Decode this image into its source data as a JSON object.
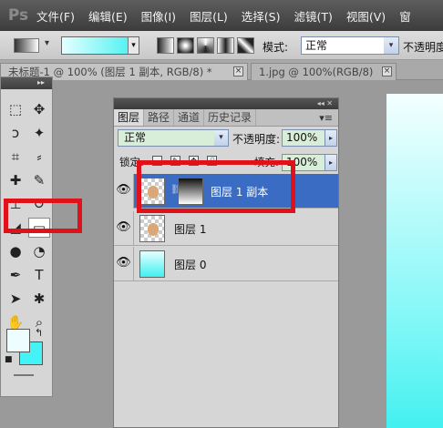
{
  "app": {
    "logo": "Ps"
  },
  "menu": [
    {
      "label": "文件(F)"
    },
    {
      "label": "编辑(E)"
    },
    {
      "label": "图像(I)"
    },
    {
      "label": "图层(L)"
    },
    {
      "label": "选择(S)"
    },
    {
      "label": "滤镜(T)"
    },
    {
      "label": "视图(V)"
    },
    {
      "label": "窗"
    }
  ],
  "options_bar": {
    "gradient_preview_colors": [
      "#e6ffff",
      "#3ff0f0"
    ],
    "mode_label": "模式:",
    "mode_value": "正常",
    "opacity_label": "不透明度"
  },
  "document_tabs": [
    {
      "label": "未标题-1 @ 100% (图层 1 副本, RGB/8) *",
      "close": "×"
    },
    {
      "label": "1.jpg @ 100%(RGB/8)",
      "close": "×"
    }
  ],
  "tools_panel": {
    "collapse_glyph": "▸▸",
    "tools": [
      {
        "name": "marquee-tool-icon",
        "glyph": "⬚"
      },
      {
        "name": "move-tool-icon",
        "glyph": "✥"
      },
      {
        "name": "lasso-tool-icon",
        "glyph": "ↄ"
      },
      {
        "name": "magic-wand-tool-icon",
        "glyph": "✦"
      },
      {
        "name": "crop-tool-icon",
        "glyph": "⌗"
      },
      {
        "name": "eyedropper-tool-icon",
        "glyph": "⸗"
      },
      {
        "name": "healing-brush-tool-icon",
        "glyph": "✚"
      },
      {
        "name": "brush-tool-icon",
        "glyph": "✎"
      },
      {
        "name": "clone-stamp-tool-icon",
        "glyph": "⊥"
      },
      {
        "name": "history-brush-tool-icon",
        "glyph": "↺"
      },
      {
        "name": "eraser-tool-icon",
        "glyph": "◢"
      },
      {
        "name": "gradient-tool-icon",
        "glyph": "▭",
        "selected": true
      },
      {
        "name": "blur-tool-icon",
        "glyph": "●"
      },
      {
        "name": "dodge-tool-icon",
        "glyph": "◔"
      },
      {
        "name": "pen-tool-icon",
        "glyph": "✒"
      },
      {
        "name": "type-tool-icon",
        "glyph": "T"
      },
      {
        "name": "path-selection-tool-icon",
        "glyph": "➤"
      },
      {
        "name": "shape-tool-icon",
        "glyph": "✱"
      },
      {
        "name": "hand-tool-icon",
        "glyph": "✋"
      },
      {
        "name": "zoom-tool-icon",
        "glyph": "⌕"
      }
    ],
    "foreground_color": "#eefdff",
    "background_color": "#44f3f5",
    "swap_glyph": "↰",
    "default_glyph": "■"
  },
  "layers_panel": {
    "collapse_glyph": "◂◂ ✕",
    "tabs": [
      {
        "label": "图层",
        "active": true
      },
      {
        "label": "路径"
      },
      {
        "label": "通道"
      },
      {
        "label": "历史记录"
      }
    ],
    "menu_glyph": "▾≡",
    "blend_mode": "正常",
    "opacity_label": "不透明度:",
    "opacity_value": "100%",
    "lock_label": "锁定:",
    "fill_label": "填充:",
    "fill_value": "100%",
    "layers": [
      {
        "name": "图层 1 副本",
        "selected": true,
        "visible": true,
        "thumb": "checker-face",
        "has_mask": true
      },
      {
        "name": "图层 1",
        "selected": false,
        "visible": true,
        "thumb": "checker-face",
        "has_mask": false
      },
      {
        "name": "图层 0",
        "selected": false,
        "visible": true,
        "thumb": "cyan",
        "has_mask": false
      }
    ]
  },
  "annotations": {
    "highlight_color": "#e0111b"
  }
}
